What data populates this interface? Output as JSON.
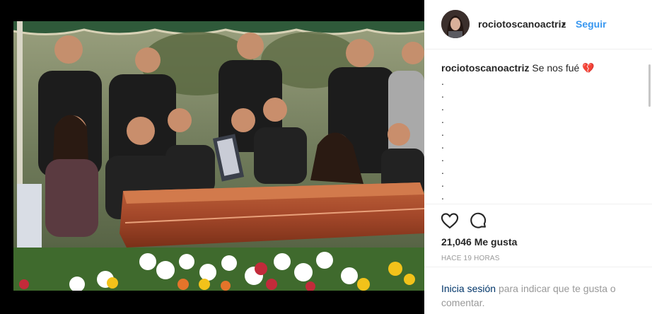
{
  "post": {
    "username": "rociotoscanoactriz",
    "separator": "•",
    "follow_label": "Seguir",
    "caption_user": "rociotoscanoactriz",
    "caption_text": "Se nos fué 💔",
    "caption_dots": [
      ".",
      ".",
      ".",
      ".",
      ".",
      ".",
      ".",
      ".",
      ".",
      "."
    ],
    "likes_count": "21,046",
    "likes_label": "Me gusta",
    "timestamp": "HACE 19 HORAS",
    "login_link": "Inicia sesión",
    "login_text": "para indicar que te gusta o comentar."
  },
  "icons": {
    "like": "heart-icon",
    "comment": "comment-icon"
  },
  "colors": {
    "link_blue": "#3897f0",
    "login_link": "#003569",
    "muted": "#999999",
    "text": "#262626"
  }
}
